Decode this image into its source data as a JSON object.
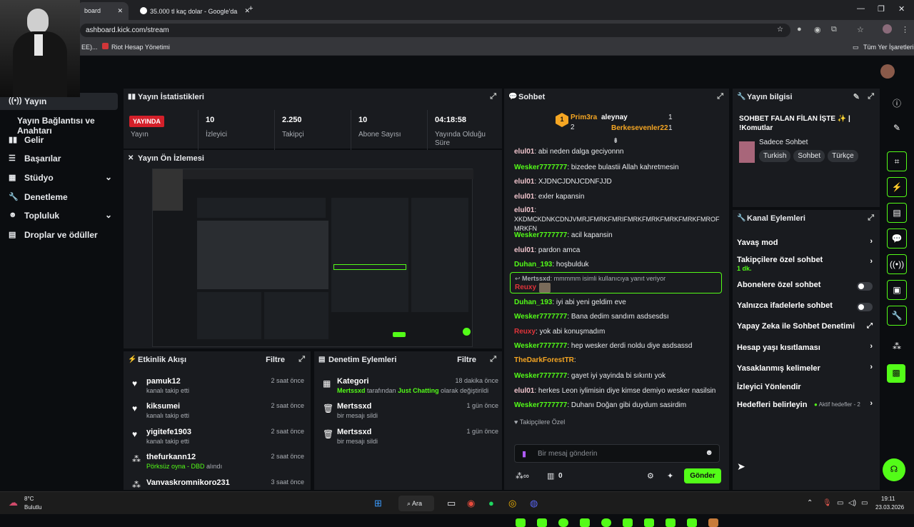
{
  "browser": {
    "tabs": [
      {
        "label": "board"
      },
      {
        "label": "35.000 tl kaç dolar - Google'da"
      }
    ],
    "url": "ashboard.kick.com/stream",
    "bookmarks": [
      "EE)...",
      "Riot Hesap Yönetimi"
    ],
    "all_bookmarks": "Tüm Yer İşaretleri"
  },
  "sidebar": {
    "items": [
      {
        "label": "Yayın",
        "icon": "broadcast-icon"
      },
      {
        "label": "Yayın Bağlantısı ve Anahtarı"
      },
      {
        "label": "Gelir",
        "icon": "chart-icon"
      },
      {
        "label": "Başarılar",
        "icon": "list-icon"
      },
      {
        "label": "Stüdyo",
        "icon": "grid-icon"
      },
      {
        "label": "Denetleme",
        "icon": "wrench-icon"
      },
      {
        "label": "Topluluk",
        "icon": "group-icon"
      },
      {
        "label": "Droplar ve ödüller",
        "icon": "gift-icon"
      }
    ]
  },
  "stats": {
    "title": "Yayın İstatistikleri",
    "live_badge": "YAYINDA",
    "items": [
      {
        "value": "",
        "label": "Yayın"
      },
      {
        "value": "10",
        "label": "İzleyici"
      },
      {
        "value": "2.250",
        "label": "Takipçi"
      },
      {
        "value": "10",
        "label": "Abone Sayısı"
      },
      {
        "value": "04:18:58",
        "label": "Yayında Olduğu Süre"
      }
    ]
  },
  "preview": {
    "title": "Yayın Ön İzlemesi"
  },
  "activity": {
    "title": "Etkinlik Akışı",
    "filter": "Filtre",
    "items": [
      {
        "name": "pamuk12",
        "sub": "kanalı takip etti",
        "time": "2 saat önce"
      },
      {
        "name": "kiksumei",
        "sub": "kanalı takip etti",
        "time": "2 saat önce"
      },
      {
        "name": "yigitefe1903",
        "sub": "kanalı takip etti",
        "time": "2 saat önce"
      },
      {
        "name": "thefurkann12",
        "sub": "Pörksüz oyna - DBD",
        "sub2": "alındı",
        "time": "2 saat önce"
      },
      {
        "name": "Vanvaskromnikoro231",
        "sub": "",
        "time": "3 saat önce"
      }
    ]
  },
  "moderation": {
    "title": "Denetim Eylemleri",
    "filter": "Filtre",
    "items": [
      {
        "name": "Kategori",
        "sub_user": "Mertssxd",
        "sub_mid": "tarafından",
        "sub_cat": "Just Chatting",
        "sub_end": "olarak değiştirildi",
        "time": "18 dakika önce"
      },
      {
        "name": "Mertssxd",
        "sub": "bir mesajı sildi",
        "time": "1 gün önce"
      },
      {
        "name": "Mertssxd",
        "sub": "bir mesajı sildi",
        "time": "1 gün önce"
      }
    ]
  },
  "chat": {
    "title": "Sohbet",
    "leaderboard": {
      "rank": "1",
      "left_user": "Prim3ra",
      "left_count": "2",
      "right": [
        {
          "user": "aleynay",
          "count": "1"
        },
        {
          "user": "Berkesevenler22",
          "count": "1"
        }
      ]
    },
    "messages": [
      {
        "user": "elul01",
        "text": "abi neden dalga geciyonnn",
        "color": "#f0c4cc"
      },
      {
        "user": "Wesker7777777",
        "text": "bizedee bulastii Allah kahretmesin",
        "color": "#53fc18"
      },
      {
        "user": "elul01",
        "text": "XJDNCJDNJCDNFJJD",
        "color": "#f0c4cc"
      },
      {
        "user": "elul01",
        "text": "exler kapansin",
        "color": "#f0c4cc"
      },
      {
        "user": "elul01",
        "text": "XKDMCKDNKCDNJVMRJFMRKFMRIFMRKFMRKFMRKFMRKFMROFMRKFN",
        "color": "#f0c4cc"
      },
      {
        "user": "Wesker7777777",
        "text": "acil kapansin",
        "color": "#53fc18"
      },
      {
        "user": "elul01",
        "text": "pardon amca",
        "color": "#f0c4cc"
      },
      {
        "user": "Duhan_193",
        "text": "hoşbulduk",
        "color": "#53fc18"
      },
      {
        "user": "Duhan_193",
        "text": "iyi abi yeni geldim eve",
        "color": "#53fc18"
      },
      {
        "user": "Wesker7777777",
        "text": "Bana dedim sandım asdsesdsı",
        "color": "#53fc18"
      },
      {
        "user": "Reuxy",
        "text": "yok abi konuşmadım",
        "color": "#e0343a"
      },
      {
        "user": "Wesker7777777",
        "text": "hep wesker derdi noldu diye asdsassd",
        "color": "#53fc18"
      },
      {
        "user": "TheDarkForestTR",
        "text": "",
        "color": "#f5a623"
      },
      {
        "user": "Wesker7777777",
        "text": "gayet iyi yayinda bi sıkıntı yok",
        "color": "#53fc18"
      },
      {
        "user": "elul01",
        "text": "herkes Leon iylimisin diye kimse demiyo wesker nasilsin",
        "color": "#f0c4cc"
      },
      {
        "user": "Wesker7777777",
        "text": "Duhanı Doğan gibi duydum sasirdim",
        "color": "#53fc18"
      }
    ],
    "reply": {
      "user": "Mertssxd",
      "text": "mmmmm isimli kullanıcıya yanıt veriyor",
      "replier": "Reuxy"
    },
    "followers_only": "Takipçilere Özel",
    "input_placeholder": "Bir mesaj gönderin",
    "count": "0",
    "send": "Gönder"
  },
  "stream_info": {
    "title": "Yayın bilgisi",
    "stream_title": "SOHBET FALAN FİLAN İŞTE ✨ | !Komutlar",
    "category": "Sadece Sohbet",
    "tags": [
      "Turkish",
      "Sohbet",
      "Türkçe"
    ]
  },
  "channel_actions": {
    "title": "Kanal Eylemleri",
    "items": [
      {
        "label": "Yavaş mod",
        "control": "chevron"
      },
      {
        "label": "Takipçilere özel sohbet",
        "sub": "1 dk.",
        "control": "chevron"
      },
      {
        "label": "Abonelere özel sohbet",
        "control": "toggle"
      },
      {
        "label": "Yalnızca ifadelerle sohbet",
        "control": "toggle"
      },
      {
        "label": "Yapay Zeka ile Sohbet Denetimi",
        "control": "external"
      },
      {
        "label": "Hesap yaşı kısıtlaması",
        "control": "chevron"
      },
      {
        "label": "Yasaklanmış kelimeler",
        "control": "chevron"
      },
      {
        "label": "İzleyici Yönlendir",
        "control": "none"
      },
      {
        "label": "Hedefleri belirleyin",
        "badge": "Aktif hedefler - 2",
        "control": "chevron"
      }
    ]
  },
  "taskbar": {
    "weather_temp": "8°C",
    "weather_desc": "Bulutlu",
    "search": "Ara",
    "time": "19:11",
    "date": "23.03.2026"
  }
}
